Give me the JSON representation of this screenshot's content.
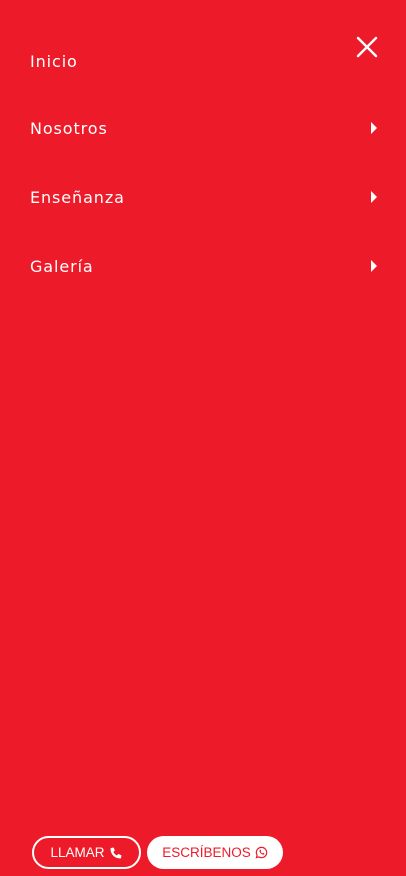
{
  "colors": {
    "background": "#ED1B2A",
    "text": "#FFFFFF"
  },
  "header": {
    "close_icon": "close-icon"
  },
  "menu": {
    "items": [
      {
        "label": "Inicio",
        "has_submenu": false
      },
      {
        "label": "Nosotros",
        "has_submenu": true,
        "icon": "caret-right-icon"
      },
      {
        "label": "Enseñanza",
        "has_submenu": true,
        "icon": "caret-right-icon"
      },
      {
        "label": "Galería",
        "has_submenu": true,
        "icon": "caret-right-icon"
      }
    ]
  },
  "actions": {
    "call": {
      "label": "LLAMAR",
      "icon": "phone-icon"
    },
    "write": {
      "label": "ESCRÍBENOS",
      "icon": "whatsapp-icon"
    }
  }
}
